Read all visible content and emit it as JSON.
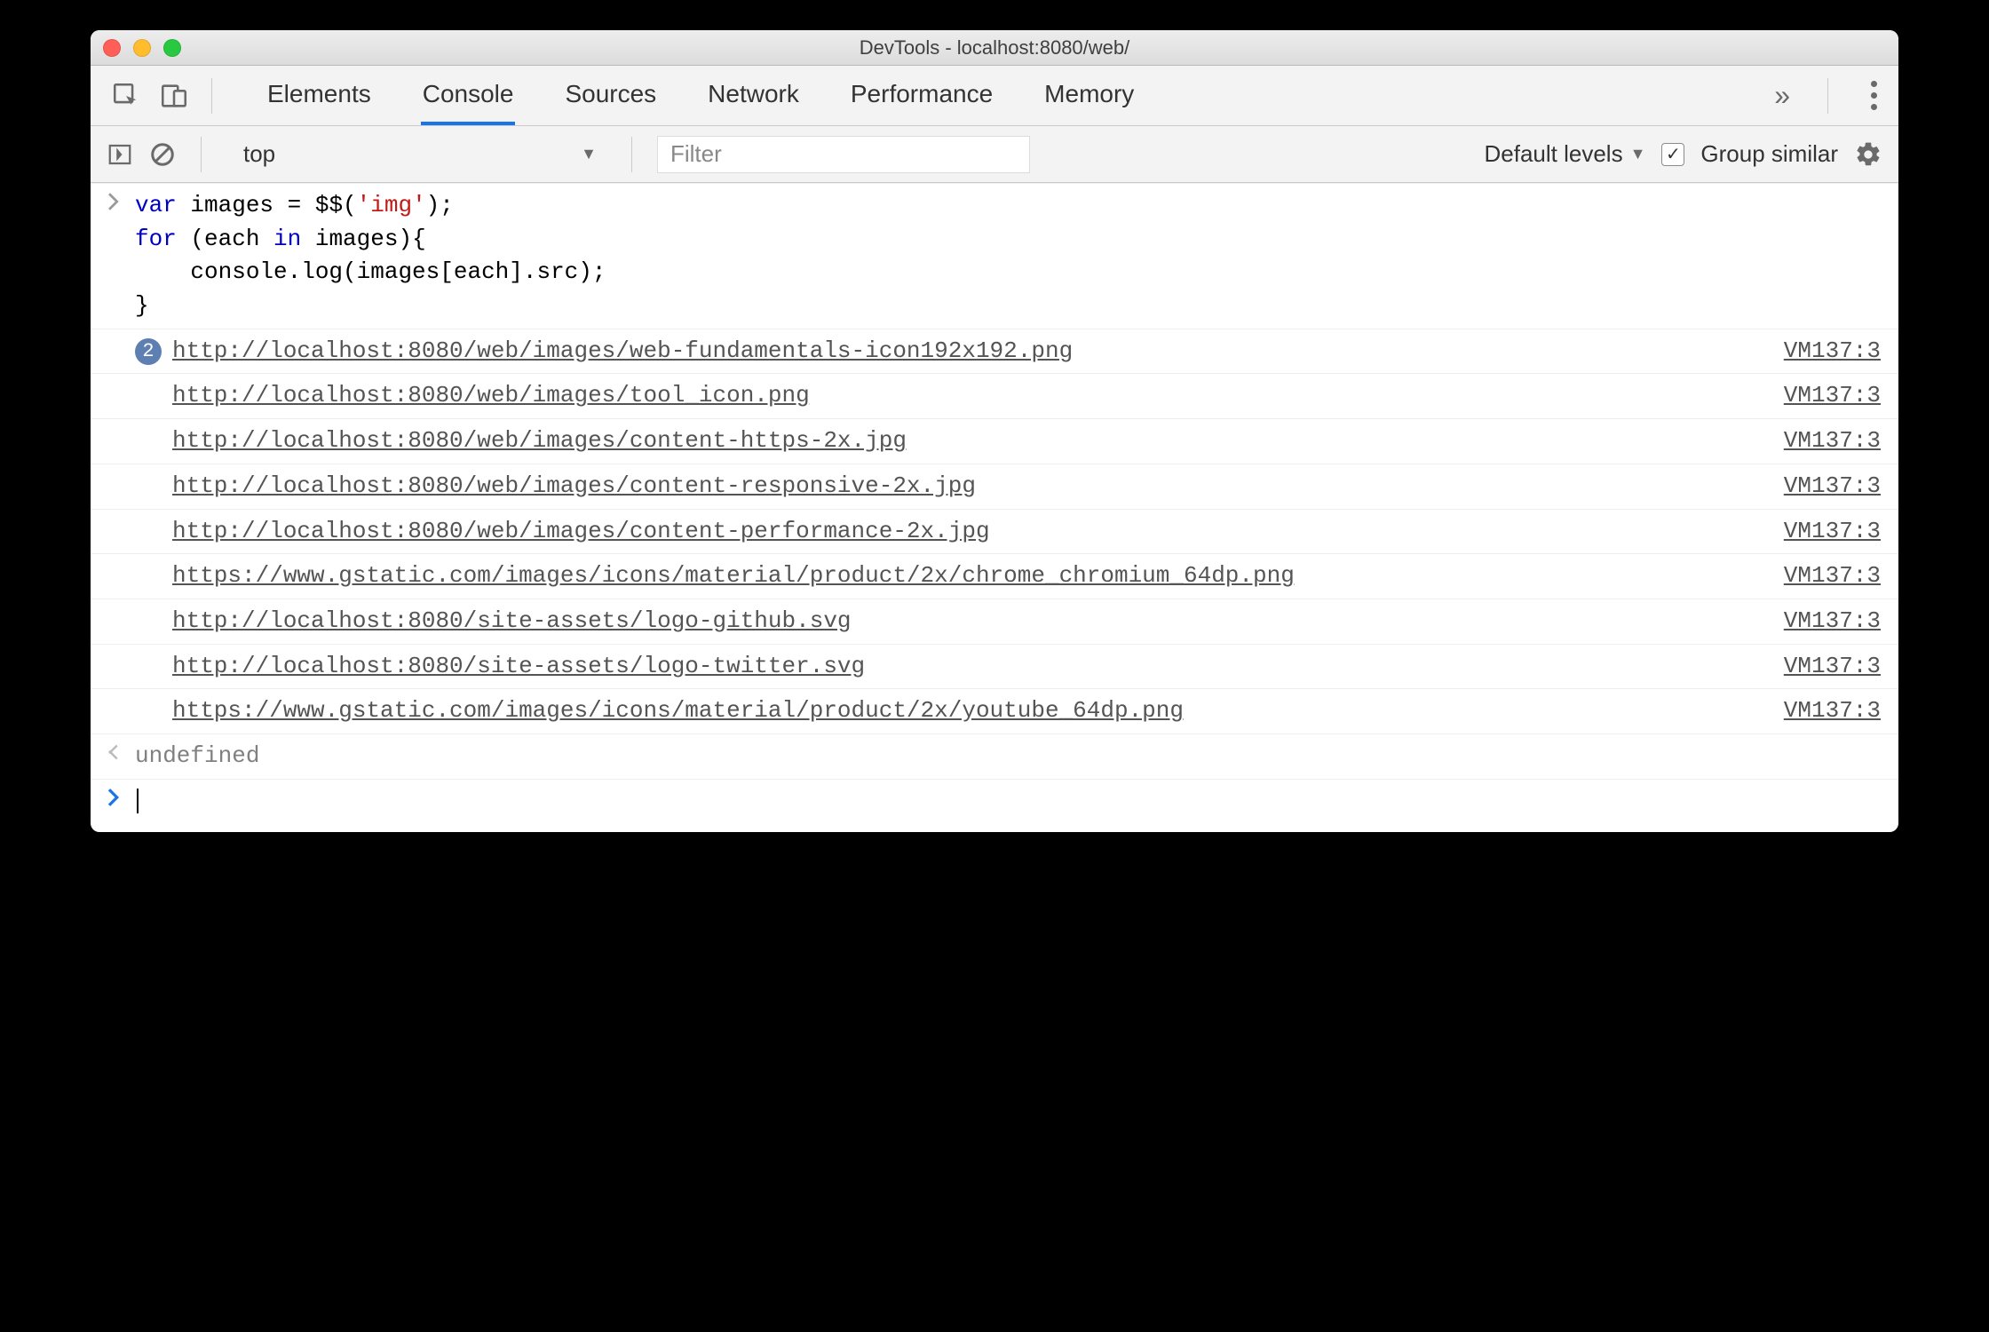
{
  "window": {
    "title": "DevTools - localhost:8080/web/"
  },
  "tabs": {
    "items": [
      "Elements",
      "Console",
      "Sources",
      "Network",
      "Performance",
      "Memory"
    ],
    "active_index": 1,
    "overflow": "»"
  },
  "toolbar": {
    "context": "top",
    "filter_placeholder": "Filter",
    "level_label": "Default levels",
    "group_similar_label": "Group similar",
    "group_similar_checked": true
  },
  "code": {
    "line1_var": "var",
    "line1_ident": " images = $$(",
    "line1_str": "'img'",
    "line1_end": ");",
    "line2_a": "for",
    "line2_b": " (each ",
    "line2_in": "in",
    "line2_c": " images){",
    "line3": "    console.log(images[each].src);",
    "line4": "}"
  },
  "logs": [
    {
      "badge": "2",
      "url": "http://localhost:8080/web/images/web-fundamentals-icon192x192.png",
      "source": "VM137:3"
    },
    {
      "url": "http://localhost:8080/web/images/tool_icon.png",
      "source": "VM137:3"
    },
    {
      "url": "http://localhost:8080/web/images/content-https-2x.jpg",
      "source": "VM137:3"
    },
    {
      "url": "http://localhost:8080/web/images/content-responsive-2x.jpg",
      "source": "VM137:3"
    },
    {
      "url": "http://localhost:8080/web/images/content-performance-2x.jpg",
      "source": "VM137:3"
    },
    {
      "url": "https://www.gstatic.com/images/icons/material/product/2x/chrome_chromium_64dp.png",
      "source": "VM137:3"
    },
    {
      "url": "http://localhost:8080/site-assets/logo-github.svg",
      "source": "VM137:3"
    },
    {
      "url": "http://localhost:8080/site-assets/logo-twitter.svg",
      "source": "VM137:3"
    },
    {
      "url": "https://www.gstatic.com/images/icons/material/product/2x/youtube_64dp.png",
      "source": "VM137:3"
    }
  ],
  "result": {
    "undefined": "undefined"
  }
}
